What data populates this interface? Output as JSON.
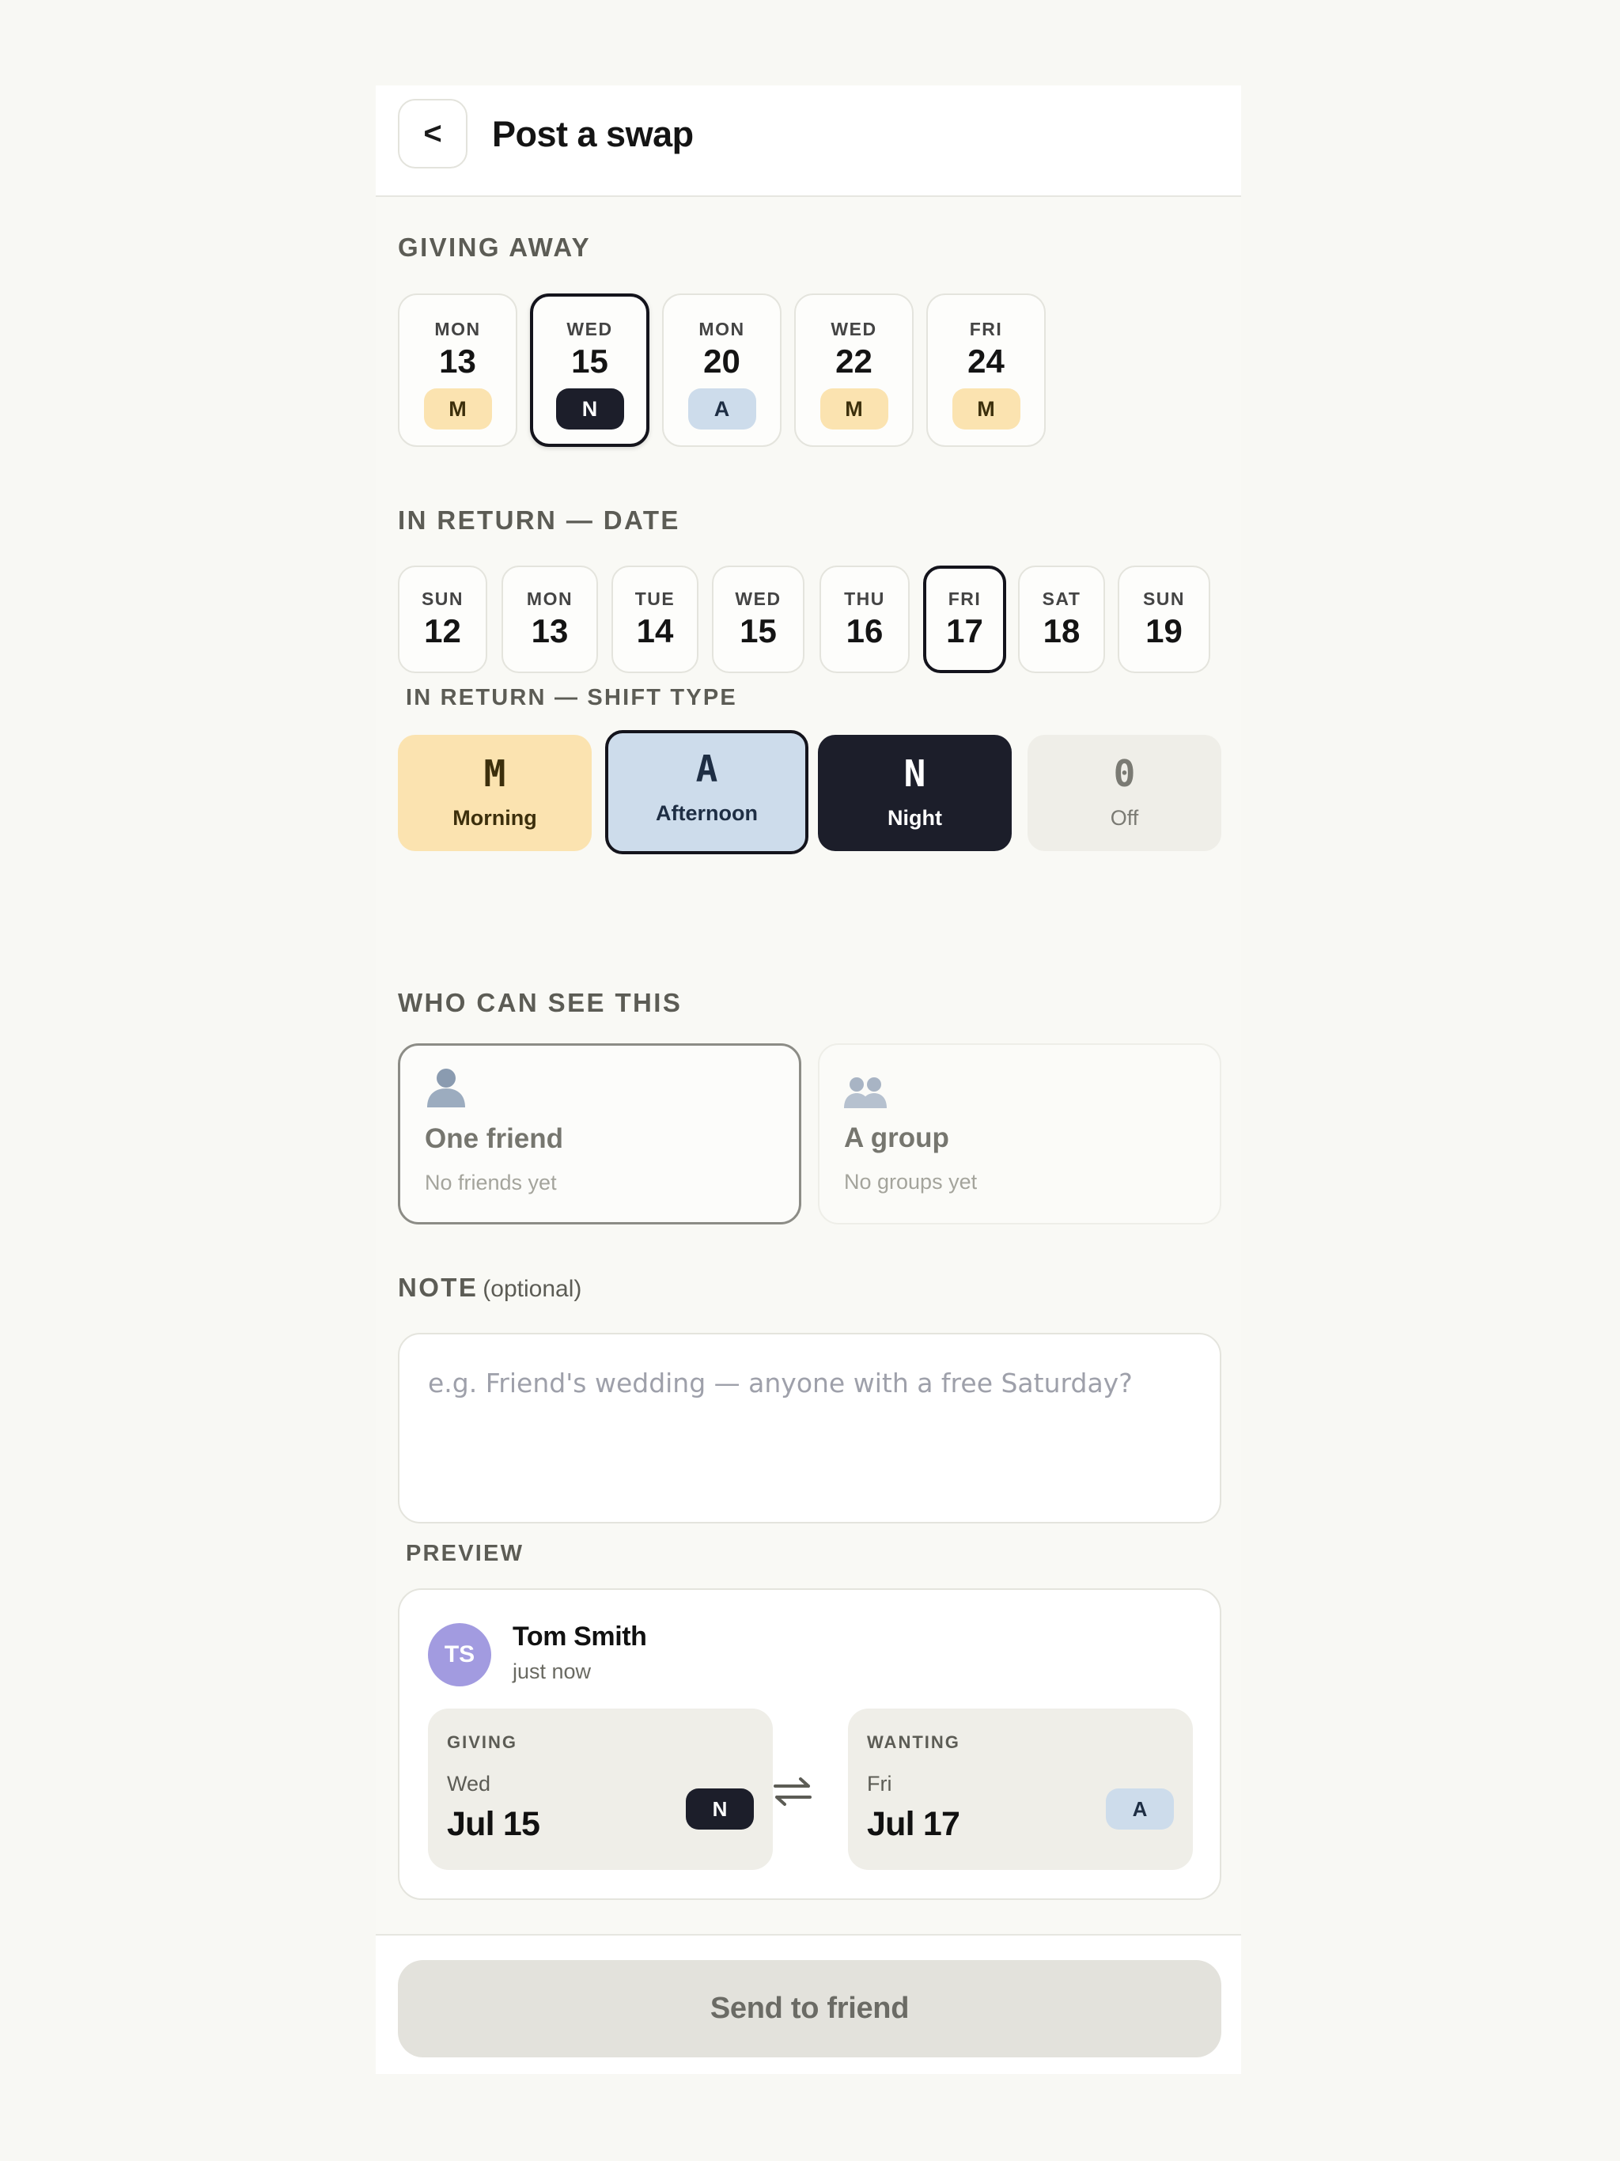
{
  "header": {
    "back_label": "<",
    "title": "Post a swap"
  },
  "giving_away": {
    "label": "GIVING AWAY",
    "days": [
      {
        "dow": "MON",
        "num": "13",
        "shift": "M"
      },
      {
        "dow": "WED",
        "num": "15",
        "shift": "N",
        "selected": true
      },
      {
        "dow": "MON",
        "num": "20",
        "shift": "A"
      },
      {
        "dow": "WED",
        "num": "22",
        "shift": "M"
      },
      {
        "dow": "FRI",
        "num": "24",
        "shift": "M"
      }
    ]
  },
  "return_date": {
    "label": "IN RETURN — DATE",
    "days": [
      {
        "dow": "SUN",
        "num": "12"
      },
      {
        "dow": "MON",
        "num": "13"
      },
      {
        "dow": "TUE",
        "num": "14"
      },
      {
        "dow": "WED",
        "num": "15"
      },
      {
        "dow": "THU",
        "num": "16"
      },
      {
        "dow": "FRI",
        "num": "17",
        "selected": true
      },
      {
        "dow": "SAT",
        "num": "18"
      },
      {
        "dow": "SUN",
        "num": "19"
      }
    ]
  },
  "shift_type": {
    "label": "IN RETURN — SHIFT TYPE",
    "options": [
      {
        "letter": "M",
        "name": "Morning"
      },
      {
        "letter": "A",
        "name": "Afternoon",
        "selected": true
      },
      {
        "letter": "N",
        "name": "Night"
      },
      {
        "letter": "0",
        "name": "Off"
      }
    ]
  },
  "audience": {
    "label": "WHO CAN SEE THIS",
    "options": [
      {
        "icon": "person-icon",
        "title": "One friend",
        "desc": "No friends yet",
        "selected": true
      },
      {
        "icon": "group-icon",
        "title": "A group",
        "desc": "No groups yet"
      }
    ]
  },
  "note": {
    "label": "NOTE",
    "optional": "(optional)",
    "placeholder": "e.g. Friend's wedding — anyone with a free Saturday?",
    "value": ""
  },
  "preview": {
    "label": "PREVIEW",
    "initials": "TS",
    "name": "Tom Smith",
    "time": "just now",
    "giving": {
      "caption": "GIVING",
      "dow": "Wed",
      "date": "Jul 15",
      "shift": "N"
    },
    "wanting": {
      "caption": "WANTING",
      "dow": "Fri",
      "date": "Jul 17",
      "shift": "A"
    }
  },
  "footer": {
    "send_label": "Send to friend"
  },
  "colors": {
    "morning": "#fbe3b0",
    "afternoon": "#cddceb",
    "night": "#1c1e2a",
    "off": "#efeee8",
    "avatar": "#a29be0"
  }
}
